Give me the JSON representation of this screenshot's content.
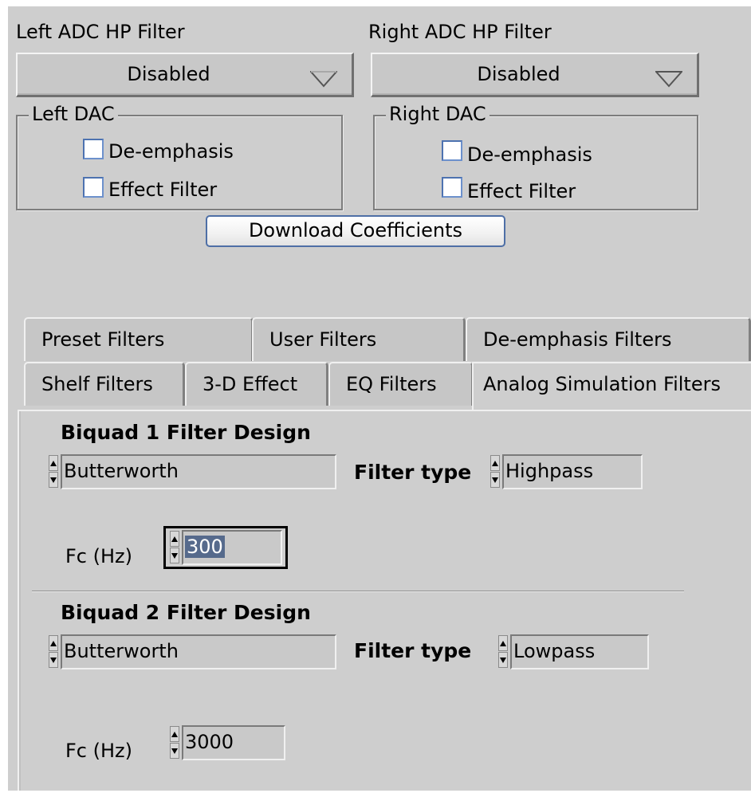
{
  "left_adc": {
    "label": "Left ADC HP Filter",
    "value": "Disabled"
  },
  "right_adc": {
    "label": "Right ADC HP Filter",
    "value": "Disabled"
  },
  "left_dac": {
    "title": "Left DAC",
    "de_emphasis": "De-emphasis",
    "effect_filter": "Effect Filter",
    "de_emphasis_checked": false,
    "effect_filter_checked": false
  },
  "right_dac": {
    "title": "Right DAC",
    "de_emphasis": "De-emphasis",
    "effect_filter": "Effect Filter",
    "de_emphasis_checked": false,
    "effect_filter_checked": false
  },
  "download_button": "Download Coefficients",
  "tabs": {
    "row1": [
      "Preset Filters",
      "User Filters",
      "De-emphasis Filters"
    ],
    "row2": [
      "Shelf Filters",
      "3-D Effect",
      "EQ Filters",
      "Analog Simulation Filters"
    ],
    "active": "Analog Simulation Filters"
  },
  "biquad1": {
    "heading": "Biquad 1 Filter Design",
    "design": "Butterworth",
    "filter_type_label": "Filter type",
    "filter_type": "Highpass",
    "fc_label": "Fc (Hz)",
    "fc": "300"
  },
  "biquad2": {
    "heading": "Biquad 2 Filter Design",
    "design": "Butterworth",
    "filter_type_label": "Filter type",
    "filter_type": "Lowpass",
    "fc_label": "Fc (Hz)",
    "fc": "3000"
  },
  "colors": {
    "background": "#cecece",
    "checkbox_border": "#4d72b0",
    "selection": "#566a8c",
    "button_border": "#4e6fa6"
  },
  "icons": {
    "dropdown": "dropdown-triangle-icon",
    "spinner": "up-down-spinner-icon"
  }
}
